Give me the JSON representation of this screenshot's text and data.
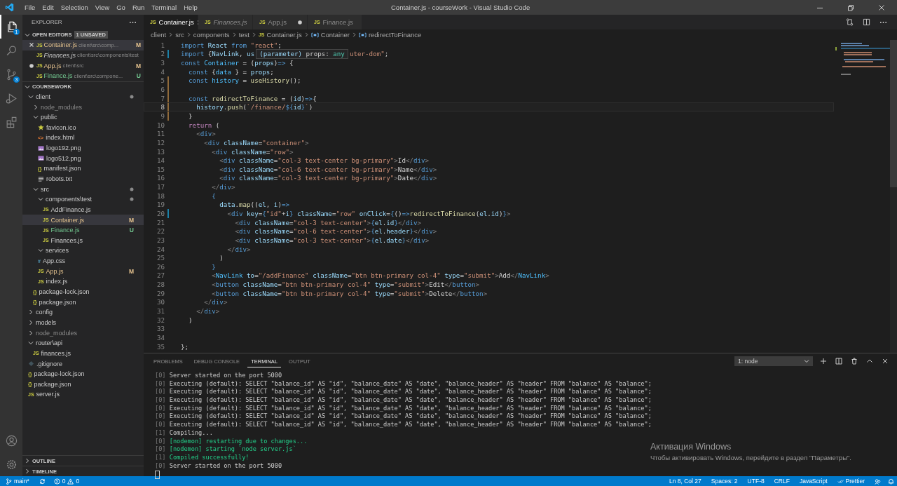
{
  "window": {
    "title": "Container.js - courseWork - Visual Studio Code",
    "menu": [
      "File",
      "Edit",
      "Selection",
      "View",
      "Go",
      "Run",
      "Terminal",
      "Help"
    ]
  },
  "activity_bar": {
    "explorer_badge": "1",
    "source_control_badge": "3"
  },
  "explorer": {
    "title": "EXPLORER",
    "open_editors": {
      "title": "OPEN EDITORS",
      "badge": "1 UNSAVED",
      "items": [
        {
          "glyph": "JS",
          "name": "Container.js",
          "path": "client\\src\\comp...",
          "badge": "M",
          "modified": true,
          "untracked": false,
          "preview": false,
          "dirty": false,
          "selected": true
        },
        {
          "glyph": "JS",
          "name": "Finances.js",
          "path": "client\\src\\components\\test",
          "modified": false,
          "untracked": false,
          "preview": true,
          "dirty": false,
          "selected": false
        },
        {
          "glyph": "JS",
          "name": "App.js",
          "path": "client\\src",
          "badge": "M",
          "modified": true,
          "untracked": false,
          "preview": false,
          "dirty": true,
          "selected": false
        },
        {
          "glyph": "JS",
          "name": "Finance.js",
          "path": "client\\src\\compone...",
          "badge": "U",
          "modified": false,
          "untracked": true,
          "preview": false,
          "dirty": false,
          "selected": false
        }
      ]
    },
    "project": "COURSEWORK",
    "tree": [
      {
        "name": "client",
        "kind": "folder",
        "expanded": true,
        "dot": true,
        "ignored": false,
        "selected": false,
        "children": [
          {
            "name": "node_modules",
            "kind": "folder",
            "expanded": false,
            "ignored": true,
            "selected": false
          },
          {
            "name": "public",
            "kind": "folder",
            "expanded": true,
            "ignored": false,
            "selected": false,
            "children": [
              {
                "name": "favicon.ico",
                "kind": "star",
                "selected": false
              },
              {
                "name": "index.html",
                "kind": "html",
                "glyph": "<>",
                "selected": false
              },
              {
                "name": "logo192.png",
                "kind": "image",
                "selected": false
              },
              {
                "name": "logo512.png",
                "kind": "image",
                "selected": false
              },
              {
                "name": "manifest.json",
                "kind": "json",
                "glyph": "{}",
                "selected": false
              },
              {
                "name": "robots.txt",
                "kind": "text",
                "selected": false
              }
            ]
          },
          {
            "name": "src",
            "kind": "folder",
            "expanded": true,
            "dot": true,
            "ignored": false,
            "selected": false,
            "children": [
              {
                "name": "components\\test",
                "kind": "folder",
                "expanded": true,
                "dot": true,
                "modified": false,
                "selected": false,
                "children": [
                  {
                    "name": "AddFinance.js",
                    "kind": "js",
                    "glyph": "JS",
                    "modified": false,
                    "untracked": false,
                    "selected": false
                  },
                  {
                    "name": "Container.js",
                    "kind": "js",
                    "glyph": "JS",
                    "badge": "M",
                    "modified": true,
                    "untracked": false,
                    "selected": true
                  },
                  {
                    "name": "Finance.js",
                    "kind": "js",
                    "glyph": "JS",
                    "badge": "U",
                    "modified": false,
                    "untracked": true,
                    "selected": false
                  },
                  {
                    "name": "Finances.js",
                    "kind": "js",
                    "glyph": "JS",
                    "modified": false,
                    "untracked": false,
                    "selected": false
                  }
                ]
              },
              {
                "name": "services",
                "kind": "folder",
                "expanded": true,
                "modified": false,
                "selected": false
              },
              {
                "name": "App.css",
                "kind": "css",
                "glyph": "#",
                "modified": false,
                "selected": false
              },
              {
                "name": "App.js",
                "kind": "js",
                "glyph": "JS",
                "badge": "M",
                "modified": true,
                "selected": false
              },
              {
                "name": "index.js",
                "kind": "js",
                "glyph": "JS",
                "modified": false,
                "selected": false
              }
            ]
          },
          {
            "name": "package-lock.json",
            "kind": "json",
            "glyph": "{}",
            "ignored": false,
            "selected": false
          },
          {
            "name": "package.json",
            "kind": "json",
            "glyph": "{}",
            "ignored": false,
            "selected": false
          }
        ]
      },
      {
        "name": "config",
        "kind": "folder",
        "expanded": false,
        "ignored": false,
        "selected": false
      },
      {
        "name": "models",
        "kind": "folder",
        "expanded": false,
        "ignored": false,
        "selected": false
      },
      {
        "name": "node_modules",
        "kind": "folder",
        "expanded": false,
        "ignored": true,
        "selected": false
      },
      {
        "name": "router\\api",
        "kind": "folder",
        "expanded": true,
        "ignored": false,
        "selected": false,
        "children": [
          {
            "name": "finances.js",
            "kind": "js",
            "glyph": "JS",
            "selected": false
          }
        ]
      },
      {
        "name": ".gitignore",
        "kind": "git",
        "ignored": false,
        "selected": false
      },
      {
        "name": "package-lock.json",
        "kind": "json",
        "glyph": "{}",
        "ignored": false,
        "selected": false
      },
      {
        "name": "package.json",
        "kind": "json",
        "glyph": "{}",
        "ignored": false,
        "selected": false
      },
      {
        "name": "server.js",
        "kind": "js",
        "glyph": "JS",
        "ignored": false,
        "selected": false
      }
    ],
    "sections": [
      "OUTLINE",
      "TIMELINE"
    ]
  },
  "tabs": [
    {
      "glyph": "JS",
      "label": "Container.js",
      "selected": true,
      "preview": false,
      "dirty": false
    },
    {
      "glyph": "JS",
      "label": "Finances.js",
      "selected": false,
      "preview": true,
      "dirty": false
    },
    {
      "glyph": "JS",
      "label": "App.js",
      "selected": false,
      "preview": false,
      "dirty": true
    },
    {
      "glyph": "JS",
      "label": "Finance.js",
      "selected": false,
      "preview": false,
      "dirty": false
    }
  ],
  "breadcrumb": [
    {
      "kind": "folder",
      "label": "client"
    },
    {
      "kind": "folder",
      "label": "src"
    },
    {
      "kind": "folder",
      "label": "components"
    },
    {
      "kind": "folder",
      "label": "test"
    },
    {
      "kind": "file",
      "glyph": "JS",
      "label": "Container.js"
    },
    {
      "kind": "symbol",
      "label": "Container"
    },
    {
      "kind": "symbol",
      "label": "redirectToFinance"
    }
  ],
  "tooltip": {
    "label": "(parameter)",
    "text": "props: ",
    "type": "any"
  },
  "code": [
    {
      "n": "1",
      "current": false,
      "tokens": [
        {
          "kind": "kw",
          "text": "import "
        },
        {
          "kind": "var",
          "text": "React "
        },
        {
          "kind": "kw",
          "text": "from "
        },
        {
          "kind": "str",
          "text": "\"react\""
        },
        {
          "kind": "punct",
          "text": ";"
        }
      ]
    },
    {
      "n": "2",
      "current": false,
      "modified": true,
      "tokens": [
        {
          "kind": "kw",
          "text": "import "
        },
        {
          "kind": "punct",
          "text": "{"
        },
        {
          "kind": "var",
          "text": "NavLink"
        },
        {
          "kind": "punct",
          "text": ", "
        },
        {
          "kind": "var",
          "text": "us"
        }
      ],
      "tail": [
        {
          "kind": "str",
          "text": "uter-dom\""
        },
        {
          "kind": "punct",
          "text": ";"
        }
      ]
    },
    {
      "n": "3",
      "current": false,
      "tokens": [
        {
          "kind": "kw",
          "text": "const "
        },
        {
          "kind": "const",
          "text": "Container "
        },
        {
          "kind": "punct",
          "text": "= ("
        },
        {
          "kind": "var",
          "text": "props"
        },
        {
          "kind": "punct",
          "text": ")"
        },
        {
          "kind": "kw",
          "text": "=> "
        },
        {
          "kind": "punct",
          "text": "{"
        }
      ]
    },
    {
      "n": "4",
      "current": false,
      "tokens": [
        {
          "kind": "kw",
          "text": "  const "
        },
        {
          "kind": "punct",
          "text": "{"
        },
        {
          "kind": "const",
          "text": "data "
        },
        {
          "kind": "punct",
          "text": "} = "
        },
        {
          "kind": "var",
          "text": "props"
        },
        {
          "kind": "punct",
          "text": ";"
        }
      ]
    },
    {
      "n": "5",
      "current": false,
      "unsaved": true,
      "tokens": [
        {
          "kind": "kw",
          "text": "  const "
        },
        {
          "kind": "const",
          "text": "history "
        },
        {
          "kind": "punct",
          "text": "= "
        },
        {
          "kind": "fn",
          "text": "useHistory"
        },
        {
          "kind": "punct",
          "text": "();"
        }
      ]
    },
    {
      "n": "6",
      "current": false,
      "unsaved": true
    },
    {
      "n": "7",
      "current": false,
      "unsaved": true,
      "tokens": [
        {
          "kind": "kw",
          "text": "  const "
        },
        {
          "kind": "fn",
          "text": "redirectToFinance "
        },
        {
          "kind": "punct",
          "text": "= ("
        },
        {
          "kind": "var",
          "text": "id"
        },
        {
          "kind": "punct",
          "text": ")"
        },
        {
          "kind": "kw",
          "text": "=>"
        },
        {
          "kind": "punct",
          "text": "{"
        }
      ]
    },
    {
      "n": "8",
      "current": true,
      "unsaved": true,
      "tokens": [
        {
          "kind": "var",
          "text": "    history"
        },
        {
          "kind": "punct",
          "text": "."
        },
        {
          "kind": "fn",
          "text": "push"
        },
        {
          "kind": "punct",
          "text": "("
        },
        {
          "kind": "str",
          "text": "`/finance/"
        },
        {
          "kind": "kw",
          "text": "${"
        },
        {
          "kind": "var",
          "text": "id"
        },
        {
          "kind": "kw",
          "text": "}"
        },
        {
          "kind": "str",
          "text": "`"
        },
        {
          "kind": "punct",
          "text": ")"
        }
      ]
    },
    {
      "n": "9",
      "current": false,
      "unsaved": true,
      "tokens": [
        {
          "kind": "punct",
          "text": "  }"
        }
      ]
    },
    {
      "n": "10",
      "current": false,
      "tokens": [
        {
          "kind": "ret",
          "text": "  return "
        },
        {
          "kind": "punct",
          "text": "("
        }
      ]
    },
    {
      "n": "11",
      "current": false,
      "tokens": [
        {
          "kind": "tagp",
          "text": "    <"
        },
        {
          "kind": "tag",
          "text": "div"
        },
        {
          "kind": "tagp",
          "text": ">"
        }
      ]
    },
    {
      "n": "12",
      "current": false,
      "tokens": [
        {
          "kind": "tagp",
          "text": "      <"
        },
        {
          "kind": "tag",
          "text": "div "
        },
        {
          "kind": "attr",
          "text": "className"
        },
        {
          "kind": "punct",
          "text": "="
        },
        {
          "kind": "str",
          "text": "\"container\""
        },
        {
          "kind": "tagp",
          "text": ">"
        }
      ]
    },
    {
      "n": "13",
      "current": false,
      "tokens": [
        {
          "kind": "tagp",
          "text": "        <"
        },
        {
          "kind": "tag",
          "text": "div "
        },
        {
          "kind": "attr",
          "text": "className"
        },
        {
          "kind": "punct",
          "text": "="
        },
        {
          "kind": "str",
          "text": "\"row\""
        },
        {
          "kind": "tagp",
          "text": ">"
        }
      ]
    },
    {
      "n": "14",
      "current": false,
      "tokens": [
        {
          "kind": "tagp",
          "text": "          <"
        },
        {
          "kind": "tag",
          "text": "div "
        },
        {
          "kind": "attr",
          "text": "className"
        },
        {
          "kind": "punct",
          "text": "="
        },
        {
          "kind": "str",
          "text": "\"col-3 text-center bg-primary\""
        },
        {
          "kind": "tagp",
          "text": ">"
        },
        {
          "kind": "punct",
          "text": "Id"
        },
        {
          "kind": "tagp",
          "text": "</"
        },
        {
          "kind": "tag",
          "text": "div"
        },
        {
          "kind": "tagp",
          "text": ">"
        }
      ]
    },
    {
      "n": "15",
      "current": false,
      "tokens": [
        {
          "kind": "tagp",
          "text": "          <"
        },
        {
          "kind": "tag",
          "text": "div "
        },
        {
          "kind": "attr",
          "text": "className"
        },
        {
          "kind": "punct",
          "text": "="
        },
        {
          "kind": "str",
          "text": "\"col-6 text-center bg-primary\""
        },
        {
          "kind": "tagp",
          "text": ">"
        },
        {
          "kind": "punct",
          "text": "Name"
        },
        {
          "kind": "tagp",
          "text": "</"
        },
        {
          "kind": "tag",
          "text": "div"
        },
        {
          "kind": "tagp",
          "text": ">"
        }
      ]
    },
    {
      "n": "16",
      "current": false,
      "tokens": [
        {
          "kind": "tagp",
          "text": "          <"
        },
        {
          "kind": "tag",
          "text": "div "
        },
        {
          "kind": "attr",
          "text": "className"
        },
        {
          "kind": "punct",
          "text": "="
        },
        {
          "kind": "str",
          "text": "\"col-3 text-center bg-primary\""
        },
        {
          "kind": "tagp",
          "text": ">"
        },
        {
          "kind": "punct",
          "text": "Date"
        },
        {
          "kind": "tagp",
          "text": "</"
        },
        {
          "kind": "tag",
          "text": "div"
        },
        {
          "kind": "tagp",
          "text": ">"
        }
      ]
    },
    {
      "n": "17",
      "current": false,
      "tokens": [
        {
          "kind": "tagp",
          "text": "        </"
        },
        {
          "kind": "tag",
          "text": "div"
        },
        {
          "kind": "tagp",
          "text": ">"
        }
      ]
    },
    {
      "n": "18",
      "current": false,
      "tokens": [
        {
          "kind": "kw",
          "text": "        {"
        }
      ]
    },
    {
      "n": "19",
      "current": false,
      "tokens": [
        {
          "kind": "var",
          "text": "          data"
        },
        {
          "kind": "punct",
          "text": "."
        },
        {
          "kind": "fn",
          "text": "map"
        },
        {
          "kind": "punct",
          "text": "(("
        },
        {
          "kind": "var",
          "text": "el"
        },
        {
          "kind": "punct",
          "text": ", "
        },
        {
          "kind": "var",
          "text": "i"
        },
        {
          "kind": "punct",
          "text": ")"
        },
        {
          "kind": "kw",
          "text": "=>"
        }
      ]
    },
    {
      "n": "20",
      "current": false,
      "modified": true,
      "tokens": [
        {
          "kind": "tagp",
          "text": "            <"
        },
        {
          "kind": "tag",
          "text": "div "
        },
        {
          "kind": "attr",
          "text": "key"
        },
        {
          "kind": "punct",
          "text": "="
        },
        {
          "kind": "kw",
          "text": "{"
        },
        {
          "kind": "str",
          "text": "\"id\""
        },
        {
          "kind": "punct",
          "text": "+"
        },
        {
          "kind": "var",
          "text": "i"
        },
        {
          "kind": "kw",
          "text": "} "
        },
        {
          "kind": "attr",
          "text": "className"
        },
        {
          "kind": "punct",
          "text": "="
        },
        {
          "kind": "str",
          "text": "\"row\" "
        },
        {
          "kind": "attr",
          "text": "onClick"
        },
        {
          "kind": "punct",
          "text": "="
        },
        {
          "kind": "kw",
          "text": "{"
        },
        {
          "kind": "punct",
          "text": "()"
        },
        {
          "kind": "kw",
          "text": "=>"
        },
        {
          "kind": "fn",
          "text": "redirectToFinance"
        },
        {
          "kind": "punct",
          "text": "("
        },
        {
          "kind": "var",
          "text": "el"
        },
        {
          "kind": "punct",
          "text": "."
        },
        {
          "kind": "var",
          "text": "id"
        },
        {
          "kind": "punct",
          "text": ")"
        },
        {
          "kind": "kw",
          "text": "}"
        },
        {
          "kind": "tagp",
          "text": ">"
        }
      ]
    },
    {
      "n": "21",
      "current": false,
      "tokens": [
        {
          "kind": "tagp",
          "text": "              <"
        },
        {
          "kind": "tag",
          "text": "div "
        },
        {
          "kind": "attr",
          "text": "className"
        },
        {
          "kind": "punct",
          "text": "="
        },
        {
          "kind": "str",
          "text": "\"col-3 text-center\""
        },
        {
          "kind": "tagp",
          "text": ">"
        },
        {
          "kind": "kw",
          "text": "{"
        },
        {
          "kind": "var",
          "text": "el"
        },
        {
          "kind": "punct",
          "text": "."
        },
        {
          "kind": "var",
          "text": "id"
        },
        {
          "kind": "kw",
          "text": "}"
        },
        {
          "kind": "tagp",
          "text": "</"
        },
        {
          "kind": "tag",
          "text": "div"
        },
        {
          "kind": "tagp",
          "text": ">"
        }
      ]
    },
    {
      "n": "22",
      "current": false,
      "tokens": [
        {
          "kind": "tagp",
          "text": "              <"
        },
        {
          "kind": "tag",
          "text": "div "
        },
        {
          "kind": "attr",
          "text": "className"
        },
        {
          "kind": "punct",
          "text": "="
        },
        {
          "kind": "str",
          "text": "\"col-6 text-center\""
        },
        {
          "kind": "tagp",
          "text": ">"
        },
        {
          "kind": "kw",
          "text": "{"
        },
        {
          "kind": "var",
          "text": "el"
        },
        {
          "kind": "punct",
          "text": "."
        },
        {
          "kind": "var",
          "text": "header"
        },
        {
          "kind": "kw",
          "text": "}"
        },
        {
          "kind": "tagp",
          "text": "</"
        },
        {
          "kind": "tag",
          "text": "div"
        },
        {
          "kind": "tagp",
          "text": ">"
        }
      ]
    },
    {
      "n": "23",
      "current": false,
      "tokens": [
        {
          "kind": "tagp",
          "text": "              <"
        },
        {
          "kind": "tag",
          "text": "div "
        },
        {
          "kind": "attr",
          "text": "className"
        },
        {
          "kind": "punct",
          "text": "="
        },
        {
          "kind": "str",
          "text": "\"col-3 text-center\""
        },
        {
          "kind": "tagp",
          "text": ">"
        },
        {
          "kind": "kw",
          "text": "{"
        },
        {
          "kind": "var",
          "text": "el"
        },
        {
          "kind": "punct",
          "text": "."
        },
        {
          "kind": "var",
          "text": "date"
        },
        {
          "kind": "kw",
          "text": "}"
        },
        {
          "kind": "tagp",
          "text": "</"
        },
        {
          "kind": "tag",
          "text": "div"
        },
        {
          "kind": "tagp",
          "text": ">"
        }
      ]
    },
    {
      "n": "24",
      "current": false,
      "tokens": [
        {
          "kind": "tagp",
          "text": "            </"
        },
        {
          "kind": "tag",
          "text": "div"
        },
        {
          "kind": "tagp",
          "text": ">"
        }
      ]
    },
    {
      "n": "25",
      "current": false,
      "tokens": [
        {
          "kind": "punct",
          "text": "          )"
        }
      ]
    },
    {
      "n": "26",
      "current": false,
      "tokens": [
        {
          "kind": "kw",
          "text": "        }"
        }
      ]
    },
    {
      "n": "27",
      "current": false,
      "tokens": [
        {
          "kind": "tagp",
          "text": "        <"
        },
        {
          "kind": "const",
          "text": "NavLink "
        },
        {
          "kind": "attr",
          "text": "to"
        },
        {
          "kind": "punct",
          "text": "="
        },
        {
          "kind": "str",
          "text": "\"/addFinance\" "
        },
        {
          "kind": "attr",
          "text": "className"
        },
        {
          "kind": "punct",
          "text": "="
        },
        {
          "kind": "str",
          "text": "\"btn btn-primary col-4\" "
        },
        {
          "kind": "attr",
          "text": "type"
        },
        {
          "kind": "punct",
          "text": "="
        },
        {
          "kind": "str",
          "text": "\"submit\""
        },
        {
          "kind": "tagp",
          "text": ">"
        },
        {
          "kind": "punct",
          "text": "Add"
        },
        {
          "kind": "tagp",
          "text": "</"
        },
        {
          "kind": "const",
          "text": "NavLink"
        },
        {
          "kind": "tagp",
          "text": ">"
        }
      ]
    },
    {
      "n": "28",
      "current": false,
      "tokens": [
        {
          "kind": "tagp",
          "text": "        <"
        },
        {
          "kind": "tag",
          "text": "button "
        },
        {
          "kind": "attr",
          "text": "className"
        },
        {
          "kind": "punct",
          "text": "="
        },
        {
          "kind": "str",
          "text": "\"btn btn-primary col-4\" "
        },
        {
          "kind": "attr",
          "text": "type"
        },
        {
          "kind": "punct",
          "text": "="
        },
        {
          "kind": "str",
          "text": "\"submit\""
        },
        {
          "kind": "tagp",
          "text": ">"
        },
        {
          "kind": "punct",
          "text": "Edit"
        },
        {
          "kind": "tagp",
          "text": "</"
        },
        {
          "kind": "tag",
          "text": "button"
        },
        {
          "kind": "tagp",
          "text": ">"
        }
      ]
    },
    {
      "n": "29",
      "current": false,
      "tokens": [
        {
          "kind": "tagp",
          "text": "        <"
        },
        {
          "kind": "tag",
          "text": "button "
        },
        {
          "kind": "attr",
          "text": "className"
        },
        {
          "kind": "punct",
          "text": "="
        },
        {
          "kind": "str",
          "text": "\"btn btn-primary col-4\" "
        },
        {
          "kind": "attr",
          "text": "type"
        },
        {
          "kind": "punct",
          "text": "="
        },
        {
          "kind": "str",
          "text": "\"submit\""
        },
        {
          "kind": "tagp",
          "text": ">"
        },
        {
          "kind": "punct",
          "text": "Delete"
        },
        {
          "kind": "tagp",
          "text": "</"
        },
        {
          "kind": "tag",
          "text": "button"
        },
        {
          "kind": "tagp",
          "text": ">"
        }
      ]
    },
    {
      "n": "30",
      "current": false,
      "tokens": [
        {
          "kind": "tagp",
          "text": "      </"
        },
        {
          "kind": "tag",
          "text": "div"
        },
        {
          "kind": "tagp",
          "text": ">"
        }
      ]
    },
    {
      "n": "31",
      "current": false,
      "tokens": [
        {
          "kind": "tagp",
          "text": "    </"
        },
        {
          "kind": "tag",
          "text": "div"
        },
        {
          "kind": "tagp",
          "text": ">"
        }
      ]
    },
    {
      "n": "32",
      "current": false,
      "tokens": [
        {
          "kind": "punct",
          "text": "  )"
        }
      ]
    },
    {
      "n": "33",
      "current": false
    },
    {
      "n": "34",
      "current": false
    },
    {
      "n": "35",
      "current": false,
      "tokens": [
        {
          "kind": "punct",
          "text": "};"
        }
      ]
    }
  ],
  "panel": {
    "tabs": [
      {
        "label": "PROBLEMS",
        "selected": false
      },
      {
        "label": "DEBUG CONSOLE",
        "selected": false
      },
      {
        "label": "TERMINAL",
        "selected": true
      },
      {
        "label": "OUTPUT",
        "selected": false
      }
    ],
    "terminal_select": "1: node",
    "lines": [
      {
        "prefix": "[0]",
        "kind": "plain",
        "text": "Server started on the port 5000"
      },
      {
        "prefix": "[0]",
        "kind": "plain",
        "text": "Executing (default): SELECT \"balance_id\" AS \"id\", \"balance_date\" AS \"date\", \"balance_header\" AS \"header\" FROM \"balance\" AS \"balance\";"
      },
      {
        "prefix": "[0]",
        "kind": "plain",
        "text": "Executing (default): SELECT \"balance_id\" AS \"id\", \"balance_date\" AS \"date\", \"balance_header\" AS \"header\" FROM \"balance\" AS \"balance\";"
      },
      {
        "prefix": "[0]",
        "kind": "plain",
        "text": "Executing (default): SELECT \"balance_id\" AS \"id\", \"balance_date\" AS \"date\", \"balance_header\" AS \"header\" FROM \"balance\" AS \"balance\";"
      },
      {
        "prefix": "[0]",
        "kind": "plain",
        "text": "Executing (default): SELECT \"balance_id\" AS \"id\", \"balance_date\" AS \"date\", \"balance_header\" AS \"header\" FROM \"balance\" AS \"balance\";"
      },
      {
        "prefix": "[0]",
        "kind": "plain",
        "text": "Executing (default): SELECT \"balance_id\" AS \"id\", \"balance_date\" AS \"date\", \"balance_header\" AS \"header\" FROM \"balance\" AS \"balance\";"
      },
      {
        "prefix": "[0]",
        "kind": "plain",
        "text": "Executing (default): SELECT \"balance_id\" AS \"id\", \"balance_date\" AS \"date\", \"balance_header\" AS \"header\" FROM \"balance\" AS \"balance\";"
      },
      {
        "prefix": "[1]",
        "kind": "plain",
        "text": "Compiling..."
      },
      {
        "prefix": "[0]",
        "kind": "success",
        "text": "[nodemon] restarting due to changes..."
      },
      {
        "prefix": "[0]",
        "kind": "success",
        "text": "[nodemon] starting `node server.js`"
      },
      {
        "prefix": "[1]",
        "kind": "success",
        "text": "Compiled successfully!"
      },
      {
        "prefix": "[0]",
        "kind": "plain",
        "text": "Server started on the port 5000"
      }
    ]
  },
  "activation_notice": {
    "title": "Активация Windows",
    "text": "Чтобы активировать Windows, перейдите в раздел \"Параметры\"."
  },
  "status_bar": {
    "branch": "main*",
    "errors": "0",
    "warnings": "0",
    "right": [
      "Ln 8, Col 27",
      "Spaces: 2",
      "UTF-8",
      "CRLF",
      "JavaScript"
    ],
    "formatter": "Prettier"
  }
}
